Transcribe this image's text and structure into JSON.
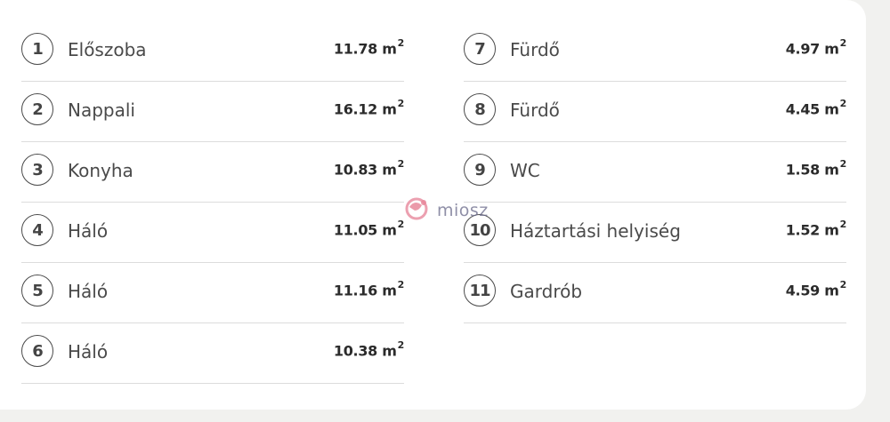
{
  "left_rooms": [
    {
      "num": "1",
      "name": "Előszoba",
      "area": "11.78 m",
      "unit_exp": "2"
    },
    {
      "num": "2",
      "name": "Nappali",
      "area": "16.12 m",
      "unit_exp": "2"
    },
    {
      "num": "3",
      "name": "Konyha",
      "area": "10.83 m",
      "unit_exp": "2"
    },
    {
      "num": "4",
      "name": "Háló",
      "area": "11.05 m",
      "unit_exp": "2"
    },
    {
      "num": "5",
      "name": "Háló",
      "area": "11.16 m",
      "unit_exp": "2"
    },
    {
      "num": "6",
      "name": "Háló",
      "area": "10.38 m",
      "unit_exp": "2"
    }
  ],
  "right_rooms": [
    {
      "num": "7",
      "name": "Fürdő",
      "area": "4.97 m",
      "unit_exp": "2"
    },
    {
      "num": "8",
      "name": "Fürdő",
      "area": "4.45 m",
      "unit_exp": "2"
    },
    {
      "num": "9",
      "name": "WC",
      "area": "1.58 m",
      "unit_exp": "2"
    },
    {
      "num": "10",
      "name": "Háztartási helyiség",
      "area": "1.52 m",
      "unit_exp": "2"
    },
    {
      "num": "11",
      "name": "Gardrób",
      "area": "4.59 m",
      "unit_exp": "2"
    }
  ],
  "watermark": {
    "text": "miosz",
    "icon": "miosz-logo-icon",
    "colors": {
      "logo": "#e0607a",
      "text": "#6a6a8a"
    }
  }
}
